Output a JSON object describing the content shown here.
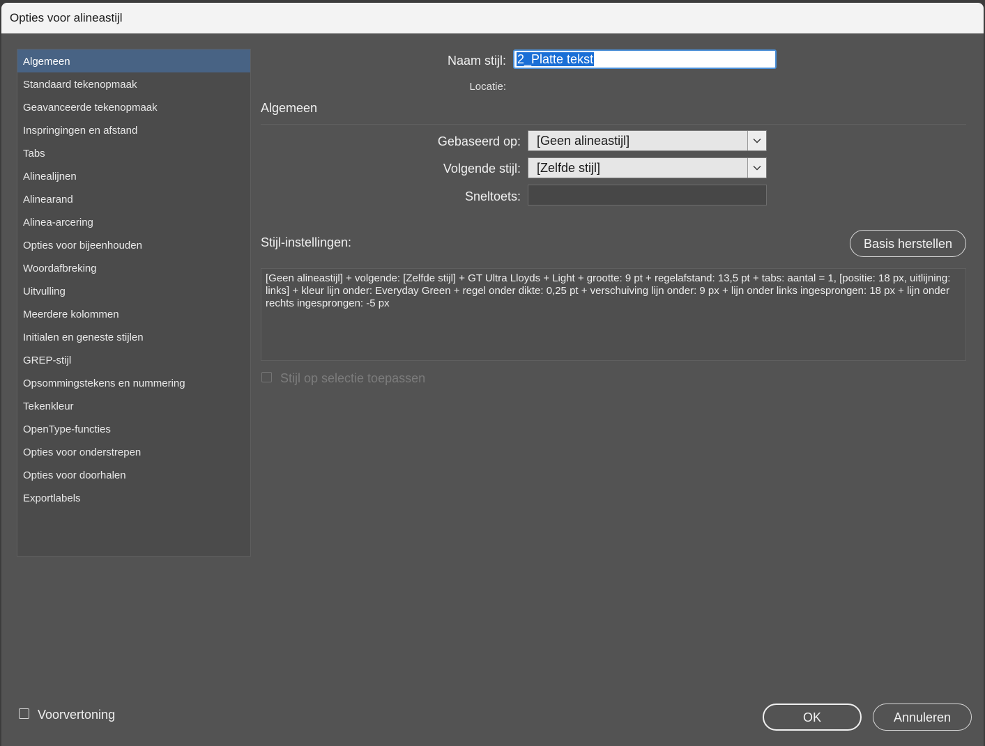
{
  "window": {
    "title": "Opties voor alineastijl"
  },
  "sidebar": {
    "items": [
      {
        "label": "Algemeen",
        "selected": true
      },
      {
        "label": "Standaard tekenopmaak"
      },
      {
        "label": "Geavanceerde tekenopmaak"
      },
      {
        "label": "Inspringingen en afstand"
      },
      {
        "label": "Tabs"
      },
      {
        "label": "Alinealijnen"
      },
      {
        "label": "Alinearand"
      },
      {
        "label": "Alinea-arcering"
      },
      {
        "label": "Opties voor bijeenhouden"
      },
      {
        "label": "Woordafbreking"
      },
      {
        "label": "Uitvulling"
      },
      {
        "label": "Meerdere kolommen"
      },
      {
        "label": "Initialen en geneste stijlen"
      },
      {
        "label": "GREP-stijl"
      },
      {
        "label": "Opsommingstekens en nummering"
      },
      {
        "label": "Tekenkleur"
      },
      {
        "label": "OpenType-functies"
      },
      {
        "label": "Opties voor onderstrepen"
      },
      {
        "label": "Opties voor doorhalen"
      },
      {
        "label": "Exportlabels"
      }
    ]
  },
  "main": {
    "style_name_label": "Naam stijl:",
    "style_name_value": "2_Platte tekst",
    "location_label": "Locatie:",
    "section_title": "Algemeen",
    "based_on_label": "Gebaseerd op:",
    "based_on_value": "[Geen alineastijl]",
    "next_style_label": "Volgende stijl:",
    "next_style_value": "[Zelfde stijl]",
    "shortcut_label": "Sneltoets:",
    "shortcut_value": "",
    "style_settings_label": "Stijl-instellingen:",
    "reset_button": "Basis herstellen",
    "style_settings_text": "[Geen alineastijl] + volgende: [Zelfde stijl] + GT Ultra Lloyds + Light + grootte: 9 pt + regelafstand: 13,5 pt + tabs: aantal = 1, [positie: 18 px, uitlijning: links]  + kleur lijn onder: Everyday Green + regel onder dikte: 0,25 pt + verschuiving lijn onder: 9 px + lijn onder links ingesprongen: 18 px + lijn onder rechts ingesprongen: -5 px",
    "apply_to_selection_label": "Stijl op selectie toepassen",
    "apply_to_selection_checked": false,
    "apply_to_selection_enabled": false
  },
  "footer": {
    "preview_label": "Voorvertoning",
    "preview_checked": false,
    "ok_button": "OK",
    "cancel_button": "Annuleren"
  },
  "colors": {
    "dialog_bg": "#535353",
    "selection_bg": "#486384",
    "input_focus": "#4a8fd8"
  }
}
